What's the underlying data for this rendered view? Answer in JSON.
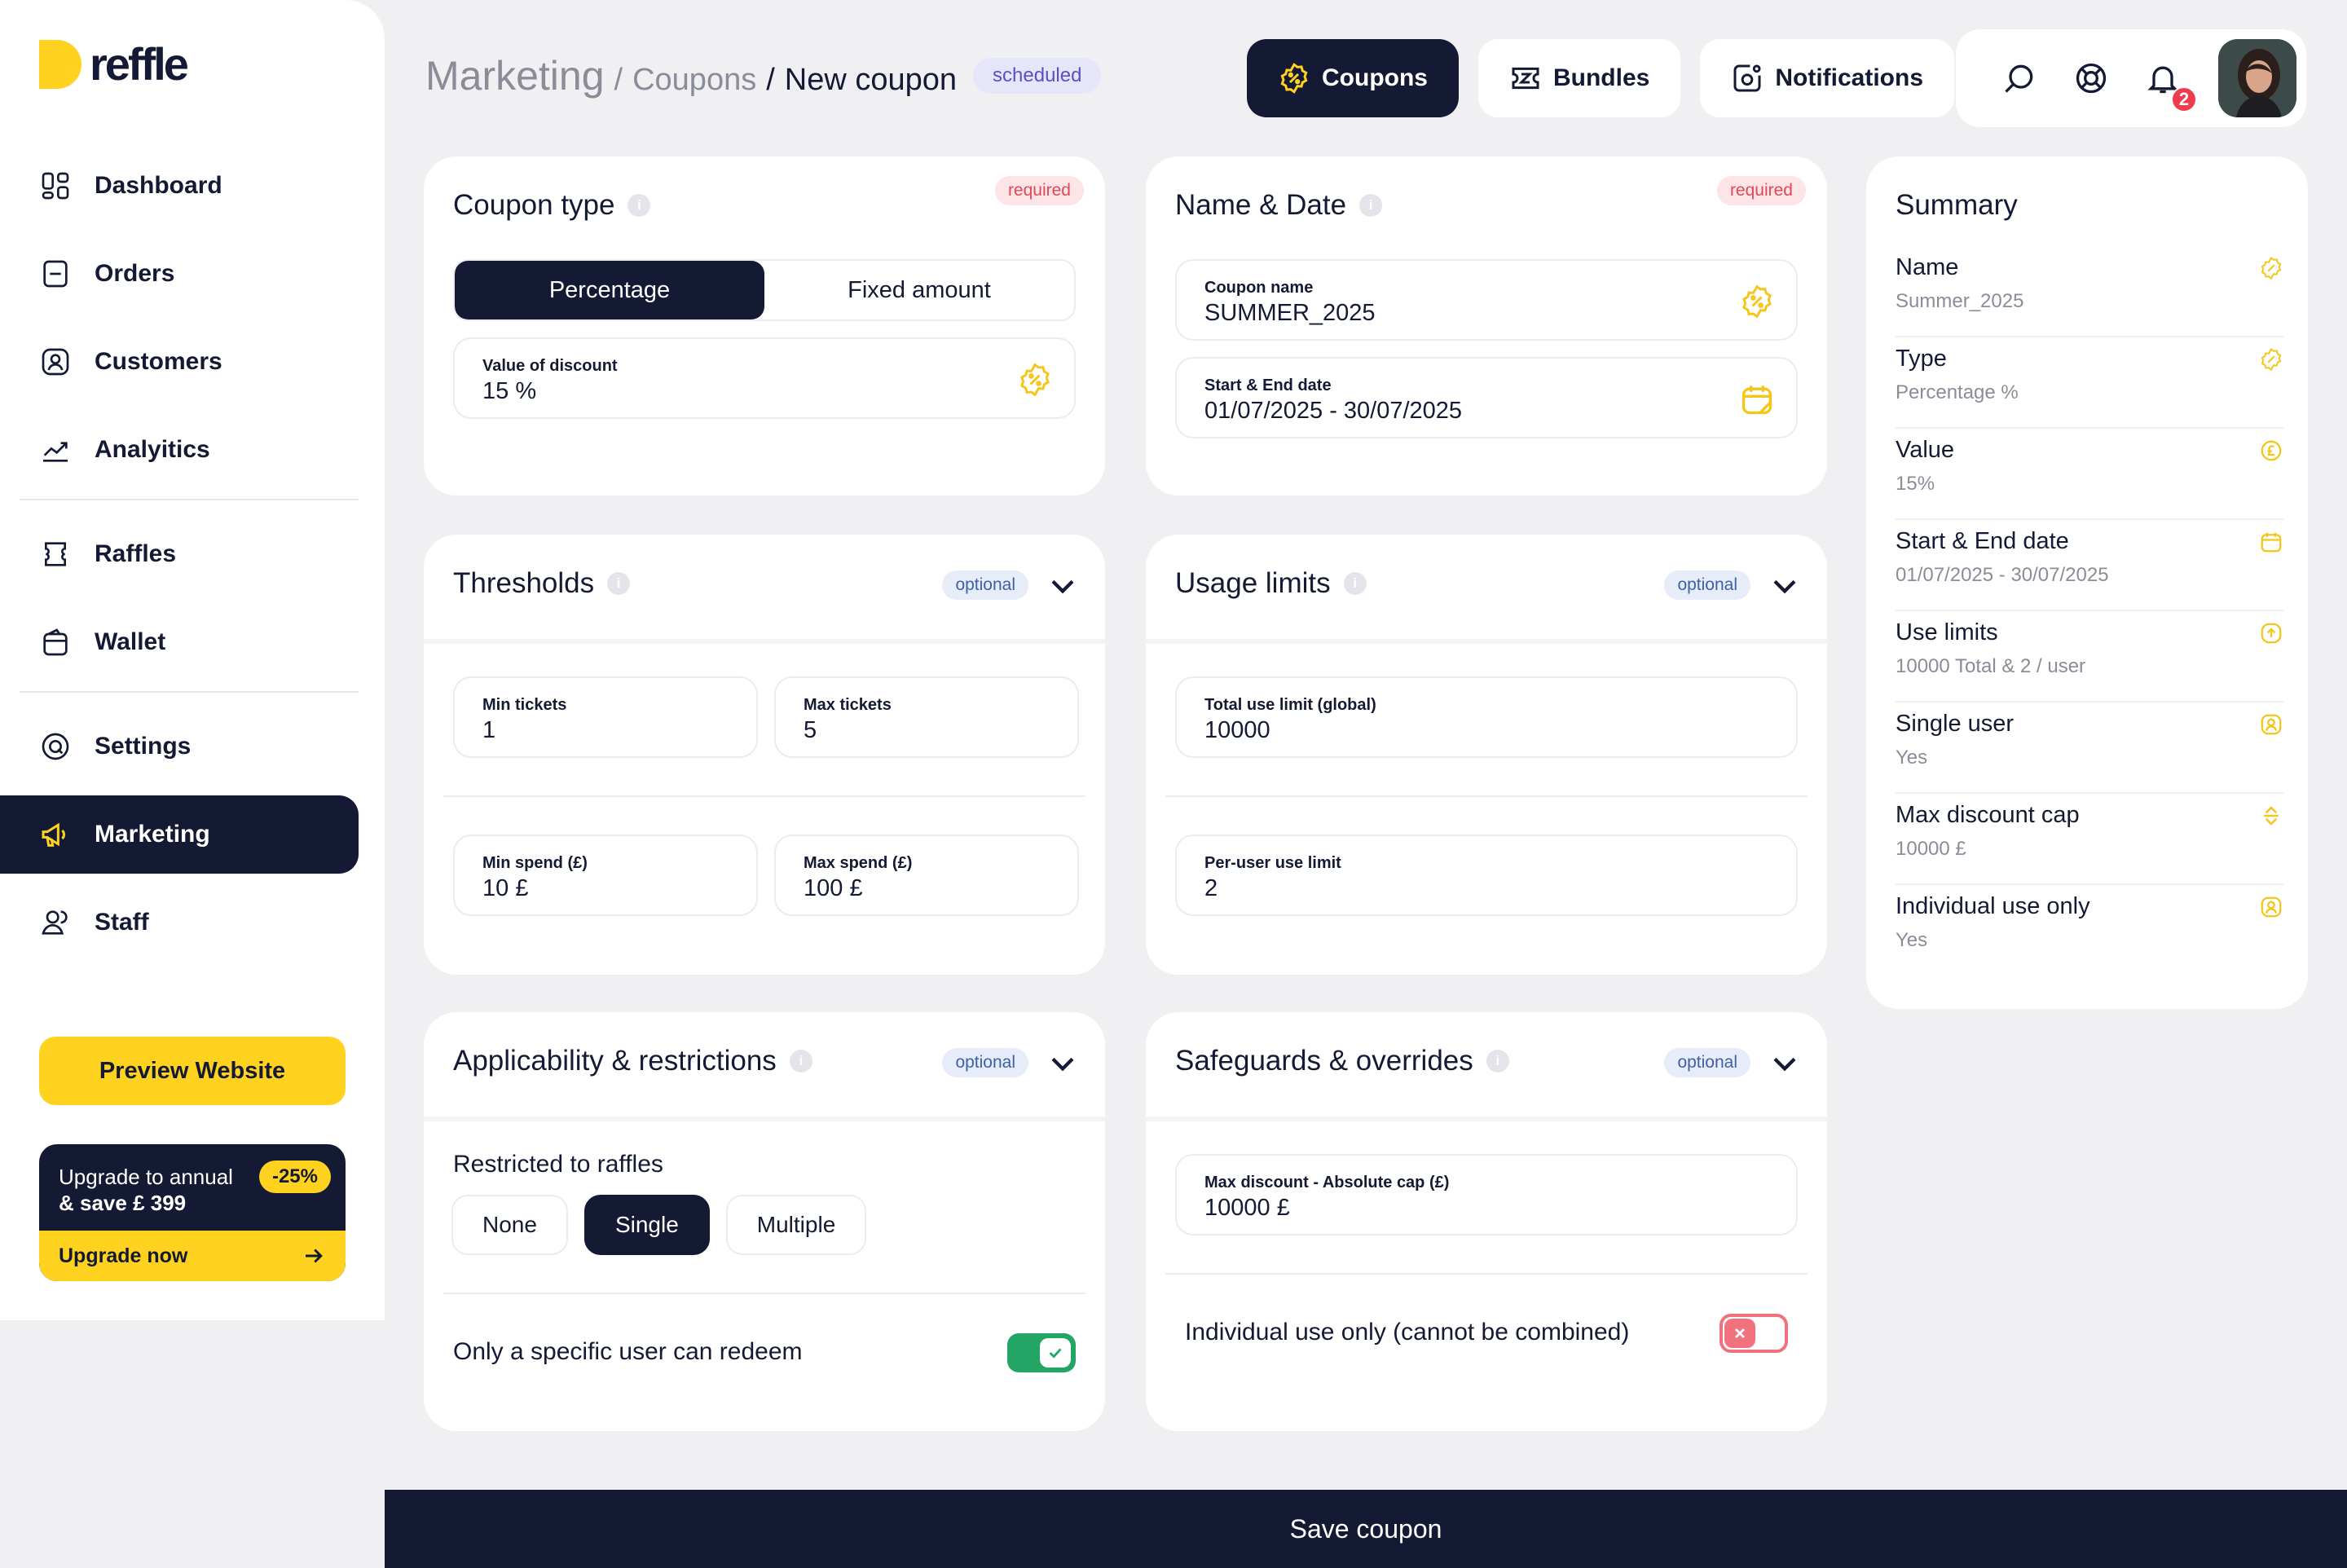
{
  "brand": {
    "name": "reffle"
  },
  "sidebar": {
    "items": [
      {
        "label": "Dashboard",
        "icon": "dashboard-icon"
      },
      {
        "label": "Orders",
        "icon": "orders-icon"
      },
      {
        "label": "Customers",
        "icon": "customers-icon"
      },
      {
        "label": "Analyitics",
        "icon": "analytics-icon"
      },
      {
        "label": "Raffles",
        "icon": "raffles-icon"
      },
      {
        "label": "Wallet",
        "icon": "wallet-icon"
      },
      {
        "label": "Settings",
        "icon": "settings-icon"
      },
      {
        "label": "Marketing",
        "icon": "megaphone-icon",
        "active": true
      },
      {
        "label": "Staff",
        "icon": "staff-icon"
      }
    ],
    "preview_label": "Preview Website",
    "upgrade": {
      "line1": "Upgrade to annual",
      "line2": "& save £ 399",
      "badge": "-25%",
      "cta": "Upgrade now"
    }
  },
  "header": {
    "breadcrumb": {
      "root": "Marketing",
      "mid": "Coupons",
      "current": "New coupon",
      "sep1": "/",
      "sep2": "/"
    },
    "status": "scheduled",
    "tabs": [
      {
        "label": "Coupons",
        "active": true
      },
      {
        "label": "Bundles"
      },
      {
        "label": "Notifications"
      }
    ],
    "notification_count": "2"
  },
  "coupon_type": {
    "title": "Coupon type",
    "tag": "required",
    "options": [
      "Percentage",
      "Fixed amount"
    ],
    "selected": "Percentage",
    "field": {
      "label": "Value of discount",
      "value": "15 %"
    }
  },
  "name_date": {
    "title": "Name & Date",
    "tag": "required",
    "name_field": {
      "label": "Coupon name",
      "value": "SUMMER_2025"
    },
    "date_field": {
      "label": "Start & End date",
      "value": "01/07/2025 - 30/07/2025"
    }
  },
  "thresholds": {
    "title": "Thresholds",
    "tag": "optional",
    "min_tickets": {
      "label": "Min tickets",
      "value": "1"
    },
    "max_tickets": {
      "label": "Max tickets",
      "value": "5"
    },
    "min_spend": {
      "label": "Min spend (£)",
      "value": "10 £"
    },
    "max_spend": {
      "label": "Max spend (£)",
      "value": "100 £"
    }
  },
  "usage_limits": {
    "title": "Usage limits",
    "tag": "optional",
    "total": {
      "label": "Total use limit (global)",
      "value": "10000"
    },
    "per_user": {
      "label": "Per-user use limit",
      "value": "2"
    }
  },
  "applicability": {
    "title": "Applicability & restrictions",
    "tag": "optional",
    "restricted_label": "Restricted to raffles",
    "options": [
      "None",
      "Single",
      "Multiple"
    ],
    "selected": "Single",
    "specific_user_label": "Only a specific user can redeem",
    "specific_user_on": true
  },
  "safeguards": {
    "title": "Safeguards & overrides",
    "tag": "optional",
    "max_discount": {
      "label": "Max discount - Absolute cap (£)",
      "value": "10000 £"
    },
    "individual_label": "Individual use only (cannot be combined)",
    "individual_on": false
  },
  "summary": {
    "title": "Summary",
    "rows": [
      {
        "key": "Name",
        "value": "Summer_2025",
        "icon": "badge-percent-icon"
      },
      {
        "key": "Type",
        "value": "Percentage %",
        "icon": "badge-percent-icon"
      },
      {
        "key": "Value",
        "value": "15%",
        "icon": "coin-pound-icon"
      },
      {
        "key": "Start & End date",
        "value": "01/07/2025 - 30/07/2025",
        "icon": "calendar-icon"
      },
      {
        "key": "Use limits",
        "value": "10000 Total & 2 / user",
        "icon": "upload-circle-icon"
      },
      {
        "key": "Single user",
        "value": "Yes",
        "icon": "user-icon"
      },
      {
        "key": "Max discount cap",
        "value": "10000 £",
        "icon": "sort-icon"
      },
      {
        "key": "Individual use only",
        "value": "Yes",
        "icon": "user-icon"
      }
    ]
  },
  "footer": {
    "save_label": "Save coupon"
  },
  "colors": {
    "navy": "#141a33",
    "accent": "#ffd21f",
    "success": "#22a565",
    "danger": "#f1727d"
  }
}
